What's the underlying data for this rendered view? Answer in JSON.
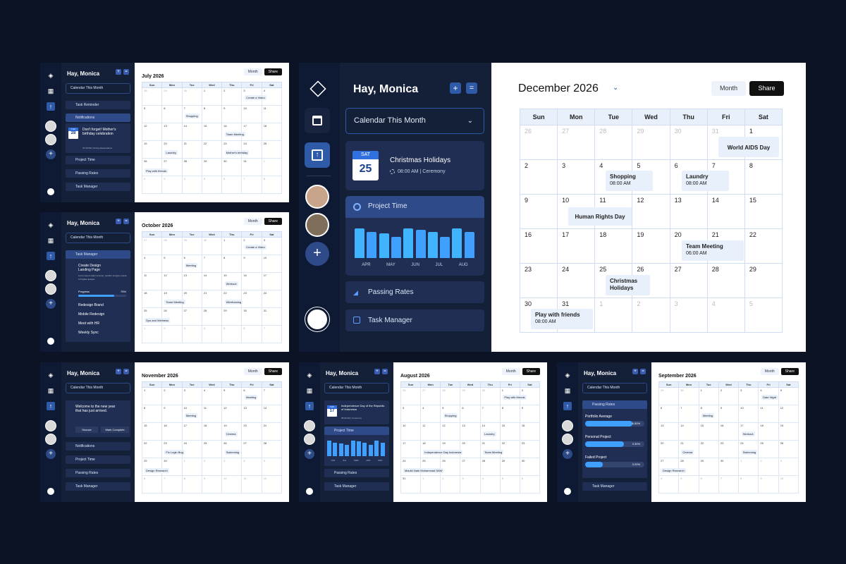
{
  "greeting": "Hay, Monica",
  "calendar_select": "Calendar This Month",
  "btn_month": "Month",
  "btn_share": "Share",
  "weekdays": [
    "Sun",
    "Mon",
    "Tue",
    "Wed",
    "Thu",
    "Fri",
    "Sat"
  ],
  "main": {
    "month": "December 2026",
    "event": {
      "day": "SAT",
      "date": "25",
      "title": "Christmas Holidays",
      "meta": "08:00 AM | Ceremony"
    },
    "project_time": "Project Time",
    "months": [
      "APR",
      "MAY",
      "JUN",
      "JUL",
      "AUG"
    ],
    "bars": [
      0.85,
      0.75,
      0.7,
      0.6,
      0.85,
      0.8,
      0.75,
      0.6,
      0.85,
      0.75
    ],
    "passing_rates": "Passing Rates",
    "task_manager": "Task Manager",
    "grid": [
      [
        "26",
        "27",
        "28",
        "29",
        "30",
        "31",
        "1"
      ],
      [
        "2",
        "3",
        "4",
        "5",
        "6",
        "7",
        "8"
      ],
      [
        "9",
        "10",
        "11",
        "12",
        "13",
        "14",
        "15"
      ],
      [
        "16",
        "17",
        "18",
        "19",
        "20",
        "21",
        "22"
      ],
      [
        "23",
        "24",
        "25",
        "26",
        "27",
        "28",
        "29"
      ],
      [
        "30",
        "31",
        "1",
        "2",
        "3",
        "4",
        "5"
      ]
    ],
    "events": {
      "world_aids": "World AIDS Day",
      "shopping": "Shopping",
      "shopping_time": "08:00 AM",
      "laundry": "Laundry",
      "laundry_time": "08:00 AM",
      "human_rights": "Human Rights Day",
      "team_meeting": "Team Meeting",
      "team_time": "06:00 AM",
      "christmas": "Christmas Holidays",
      "play": "Play with friends",
      "play_time": "08:00 AM"
    }
  },
  "panels": {
    "july": {
      "month": "July 2026",
      "sidebar": [
        "Task Reminder",
        "Notifications",
        "Project Time",
        "Passing Rates",
        "Task Manager"
      ],
      "card_title": "Don't forget! Mother's birthday celebration",
      "card_day": "THU",
      "card_date": "28",
      "card_meta": "07:00 PM | Dining Reservations",
      "events": [
        "Create a Video",
        "Shopping",
        "Team Meeting",
        "Laundry",
        "Mother's birthday",
        "Play with friends"
      ]
    },
    "october": {
      "month": "October 2026",
      "sidebar_title": "Task Manager",
      "task": "Create Design Landing Page",
      "task_desc": "Lorem ipsum dolor sit amet, porttitor congue massa a fringilla quisque",
      "progress_label": "Progress",
      "progress": "75%",
      "items": [
        "Redesign Brand",
        "Mobile Redesign",
        "Meet with HR",
        "Weekly Sync"
      ],
      "events": [
        "Create a Video",
        "Meeting",
        "Workout",
        "Team Meeting",
        "Wireframing",
        "Spa and Wellness"
      ]
    },
    "november": {
      "month": "November 2026",
      "welcome": "Welcome to the new year that has just arrived.",
      "snooze": "Snooze",
      "mark": "Mark Complete",
      "sidebar": [
        "Notifications",
        "Project Time",
        "Passing Rates",
        "Task Manager"
      ],
      "events": [
        "Meeting",
        "Meeting",
        "Cinema",
        "Fix Login Bug",
        "Swimming",
        "Design Research"
      ]
    },
    "august": {
      "month": "August 2026",
      "card_title": "Independence Day of the Republic of Indonesia",
      "card_day": "THU",
      "card_date": "17",
      "card_meta": "08:00 AM | Ceremony",
      "sidebar": [
        "Project Time",
        "Passing Rates",
        "Task Manager"
      ],
      "months": [
        "JUN",
        "JUL",
        "MAR",
        "APR",
        "MAY"
      ],
      "events": [
        "Play with friends",
        "Shopping",
        "Laundry",
        "Independence Day Indonesia",
        "Team Meeting",
        "Maulid Nabi Muhammad SAW"
      ]
    },
    "september": {
      "month": "September 2026",
      "sidebar": [
        "Passing Rates",
        "Task Manager"
      ],
      "rates": [
        {
          "label": "Portfolio Average",
          "value": "6.50%",
          "fill": 0.8
        },
        {
          "label": "Personal Project",
          "value": "3.30%",
          "fill": 0.65
        },
        {
          "label": "Failed Project",
          "value": "3.20%",
          "fill": 0.3
        }
      ],
      "events": [
        "Date Night",
        "Meeting",
        "Workout",
        "Cinema",
        "Swimming",
        "Design Research"
      ]
    }
  }
}
